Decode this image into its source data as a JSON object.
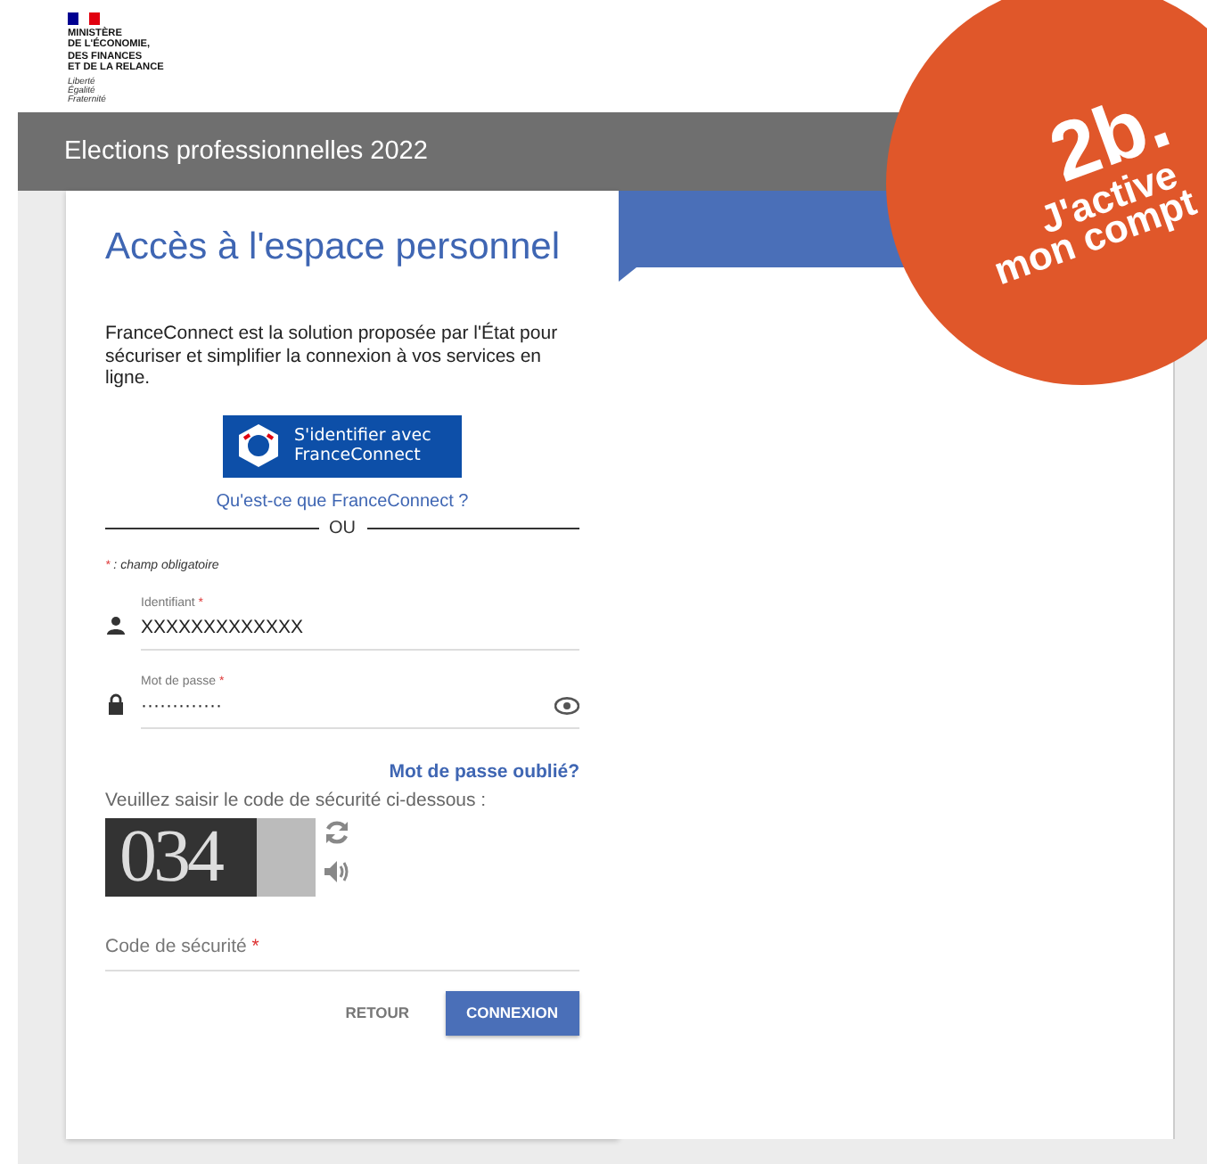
{
  "header": {
    "ministry_lines": [
      "MINISTÈRE",
      "DE L'ÉCONOMIE,",
      "DES FINANCES",
      "ET DE LA RELANCE"
    ],
    "motto_lines": [
      "Liberté",
      "Égalité",
      "Fraternité"
    ]
  },
  "banner": {
    "title": "Elections professionnelles 2022"
  },
  "card": {
    "title": "Accès à l'espace personnel",
    "intro": "FranceConnect est la solution proposée par l'État pour sécuriser et simplifier la connexion à vos services en ligne.",
    "franceconnect_button": {
      "line1": "S'identifier avec",
      "line2": "FranceConnect"
    },
    "franceconnect_link": "Qu'est-ce que FranceConnect ?",
    "separator": "OU",
    "required_note": {
      "mark": "*",
      "text": " : champ obligatoire"
    },
    "fields": [
      {
        "kind": "text",
        "label": "Identifiant",
        "required": true,
        "value": "XXXXXXXXXXXXX"
      },
      {
        "kind": "password",
        "label": "Mot de passe",
        "required": true,
        "value": "·············"
      }
    ],
    "forgot_link": "Mot de passe oublié?",
    "captcha_prompt": "Veuillez saisir le code de sécurité ci-dessous :",
    "captcha_text": "034",
    "code_field": {
      "label": "Code de sécurité",
      "required": true
    },
    "buttons": [
      {
        "kind": "secondary",
        "label": "RETOUR"
      },
      {
        "kind": "primary",
        "label": "CONNEXION"
      }
    ]
  },
  "badge": {
    "number": "2b.",
    "lines": [
      "J'active",
      "mon compt"
    ]
  }
}
